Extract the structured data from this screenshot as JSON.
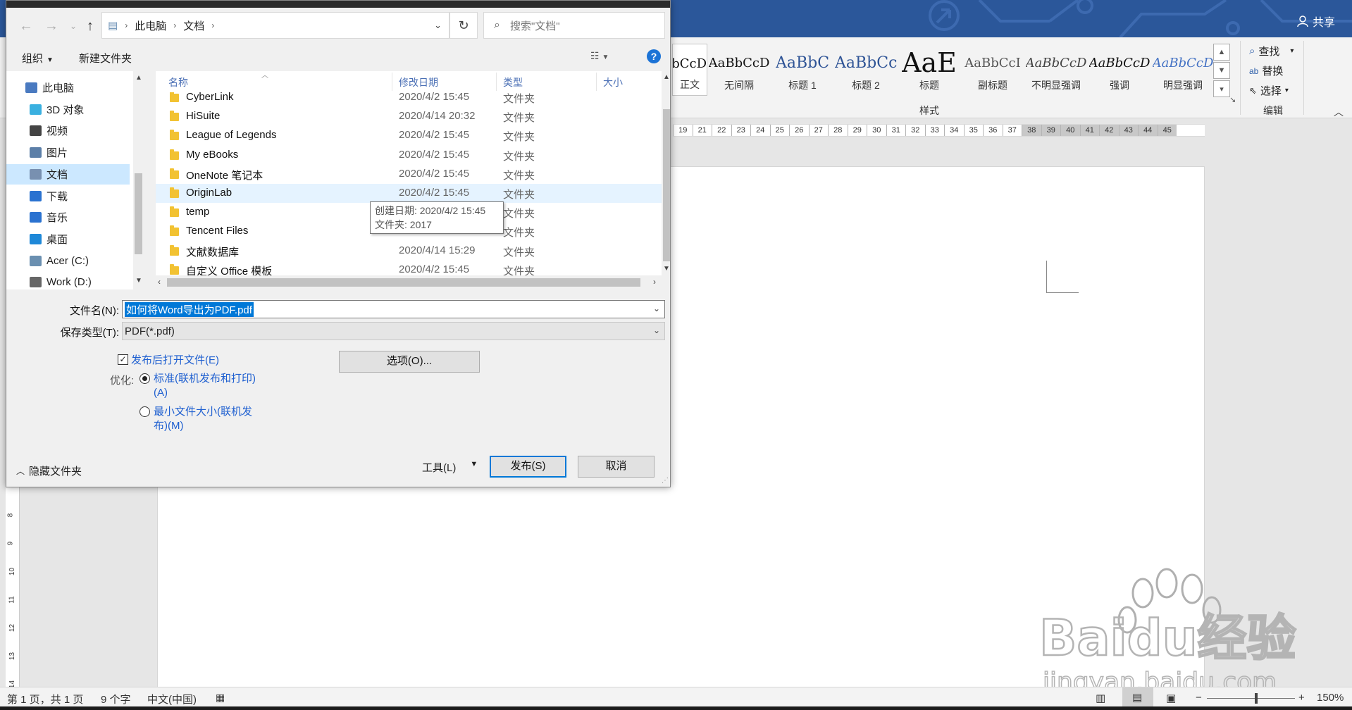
{
  "word": {
    "share_label": "共享",
    "styles": [
      {
        "sample": "AaBbCcD",
        "name": "正文",
        "color": "#111111"
      },
      {
        "sample": "AaBbCcD",
        "name": "无间隔",
        "color": "#111111"
      },
      {
        "sample": "AaBbC",
        "name": "标题 1",
        "color": "#2f5496"
      },
      {
        "sample": "AaBbCc",
        "name": "标题 2",
        "color": "#2f5496"
      },
      {
        "sample": "AaE",
        "name": "标题",
        "color": "#111111"
      },
      {
        "sample": "AaBbCcI",
        "name": "副标题",
        "color": "#555555"
      },
      {
        "sample": "AaBbCcD",
        "name": "不明显强调",
        "color": "#444444"
      },
      {
        "sample": "AaBbCcD",
        "name": "强调",
        "color": "#111111"
      },
      {
        "sample": "AaBbCcD",
        "name": "明显强调",
        "color": "#4472c4"
      }
    ],
    "styles_group_label": "样式",
    "editing": {
      "find": "查找",
      "replace": "替换",
      "select": "选择",
      "group_label": "编辑"
    },
    "ruler_numbers": [
      "19",
      "21",
      "22",
      "23",
      "24",
      "25",
      "26",
      "27",
      "28",
      "29",
      "30",
      "31",
      "32",
      "33",
      "34",
      "35",
      "36",
      "37",
      "38",
      "39",
      "40",
      "41",
      "42",
      "43",
      "44",
      "45"
    ],
    "vruler_numbers": [
      "8",
      "9",
      "10",
      "11",
      "12",
      "13",
      "14"
    ],
    "status": {
      "page": "第 1 页，共 1 页",
      "words": "9 个字",
      "language": "中文(中国)",
      "zoom": "150%"
    },
    "watermark": {
      "brand": "Baidu经验",
      "url": "jingyan.baidu.com"
    }
  },
  "dialog": {
    "breadcrumb": [
      "此电脑",
      "文档"
    ],
    "search_placeholder": "搜索\"文档\"",
    "organize_label": "组织",
    "new_folder_label": "新建文件夹",
    "help_glyph": "?",
    "nav_items": [
      {
        "label": "此电脑",
        "icon": "computer-icon",
        "color": "#4a7ac0"
      },
      {
        "label": "3D 对象",
        "icon": "cube-icon",
        "color": "#3ab0e0"
      },
      {
        "label": "视频",
        "icon": "video-icon",
        "color": "#444444"
      },
      {
        "label": "图片",
        "icon": "picture-icon",
        "color": "#5c7fa8"
      },
      {
        "label": "文档",
        "icon": "document-icon",
        "color": "#7890b0"
      },
      {
        "label": "下载",
        "icon": "download-icon",
        "color": "#2a72d0"
      },
      {
        "label": "音乐",
        "icon": "music-icon",
        "color": "#2a72d0"
      },
      {
        "label": "桌面",
        "icon": "desktop-icon",
        "color": "#1e88d8"
      },
      {
        "label": "Acer (C:)",
        "icon": "drive-c-icon",
        "color": "#6a8fb0"
      },
      {
        "label": "Work (D:)",
        "icon": "drive-d-icon",
        "color": "#666666"
      }
    ],
    "columns": {
      "name": "名称",
      "date": "修改日期",
      "type": "类型",
      "size": "大小"
    },
    "files": [
      {
        "name": "CyberLink",
        "date": "2020/4/2 15:45",
        "type": "文件夹"
      },
      {
        "name": "HiSuite",
        "date": "2020/4/14 20:32",
        "type": "文件夹"
      },
      {
        "name": "League of Legends",
        "date": "2020/4/2 15:45",
        "type": "文件夹"
      },
      {
        "name": "My eBooks",
        "date": "2020/4/2 15:45",
        "type": "文件夹"
      },
      {
        "name": "OneNote 笔记本",
        "date": "2020/4/2 15:45",
        "type": "文件夹"
      },
      {
        "name": "OriginLab",
        "date": "2020/4/2 15:45",
        "type": "文件夹"
      },
      {
        "name": "temp",
        "date": "",
        "type": "文件夹"
      },
      {
        "name": "Tencent Files",
        "date": "",
        "type": "文件夹"
      },
      {
        "name": "文献数据库",
        "date": "2020/4/14 15:29",
        "type": "文件夹"
      },
      {
        "name": "自定义 Office 模板",
        "date": "2020/4/2 15:45",
        "type": "文件夹"
      }
    ],
    "tooltip": {
      "line1": "创建日期: 2020/4/2 15:45",
      "line2": "文件夹: 2017"
    },
    "filename_label": "文件名(N):",
    "filename_value": "如何将Word导出为PDF.pdf",
    "filetype_label": "保存类型(T):",
    "filetype_value": "PDF(*.pdf)",
    "open_after_label": "发布后打开文件(E)",
    "options_button": "选项(O)...",
    "optimize_label": "优化:",
    "optimize_standard": [
      "标准(联机发布和打印)",
      "(A)"
    ],
    "optimize_min": [
      "最小文件大小(联机发",
      "布)(M)"
    ],
    "hide_folders_label": "隐藏文件夹",
    "tools_label": "工具(L)",
    "publish_button": "发布(S)",
    "cancel_button": "取消"
  }
}
